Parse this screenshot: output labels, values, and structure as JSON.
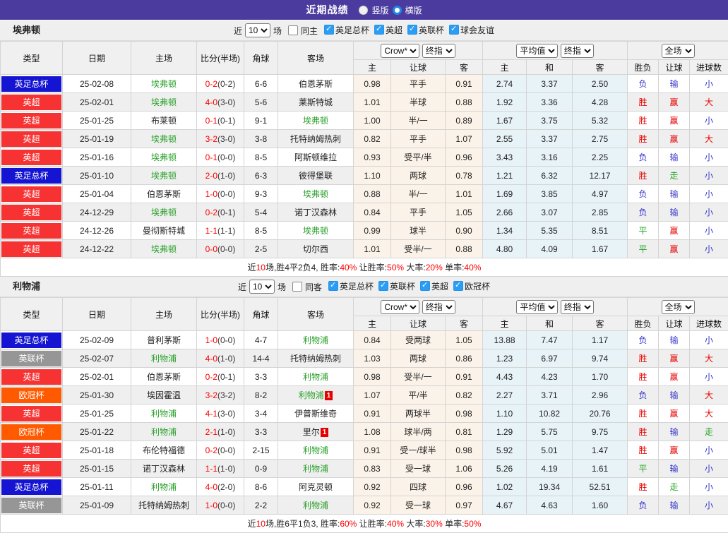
{
  "title_bar": {
    "title": "近期战绩",
    "options": [
      {
        "label": "竖版",
        "selected": false
      },
      {
        "label": "横版",
        "selected": true
      }
    ]
  },
  "selects": {
    "book": "Crow*",
    "final": "终指",
    "avg": "平均值",
    "scope": "全场"
  },
  "table_header": {
    "type": "类型",
    "date": "日期",
    "home": "主场",
    "score": "比分(半场)",
    "corner": "角球",
    "away": "客场",
    "sub": [
      "主",
      "让球",
      "客",
      "主",
      "和",
      "客",
      "胜负",
      "让球",
      "进球数"
    ]
  },
  "league_colors": {
    "英足总杯": "#1414d2",
    "英超": "#f73232",
    "英联杯": "#969696",
    "欧冠杯": "#ff5a00",
    "球会友谊": "#969696"
  },
  "sections": [
    {
      "team": "埃弗顿",
      "filter": {
        "near_label": "近",
        "count": "10",
        "matches_label": "场",
        "same_label": "同主",
        "same_checked": false,
        "leagues": [
          "英足总杯",
          "英超",
          "英联杯",
          "球会友谊"
        ]
      },
      "rows": [
        {
          "league": "英足总杯",
          "date": "25-02-08",
          "home": "埃弗顿",
          "home_active": true,
          "score": "0-2",
          "half": "(0-2)",
          "corners": "6-6",
          "away": "伯恩茅斯",
          "away_active": false,
          "asian": [
            "0.98",
            "平手",
            "0.91"
          ],
          "euro": [
            "2.74",
            "3.37",
            "2.50"
          ],
          "results": [
            {
              "text": "负",
              "color": "blue"
            },
            {
              "text": "输",
              "color": "blue"
            },
            {
              "text": "小",
              "color": "blue"
            }
          ]
        },
        {
          "league": "英超",
          "date": "25-02-01",
          "home": "埃弗顿",
          "home_active": true,
          "score": "4-0",
          "half": "(3-0)",
          "corners": "5-6",
          "away": "莱斯特城",
          "away_active": false,
          "asian": [
            "1.01",
            "半球",
            "0.88"
          ],
          "euro": [
            "1.92",
            "3.36",
            "4.28"
          ],
          "results": [
            {
              "text": "胜",
              "color": "red"
            },
            {
              "text": "赢",
              "color": "red"
            },
            {
              "text": "大",
              "color": "red"
            }
          ]
        },
        {
          "league": "英超",
          "date": "25-01-25",
          "home": "布莱顿",
          "home_active": false,
          "score": "0-1",
          "half": "(0-1)",
          "corners": "9-1",
          "away": "埃弗顿",
          "away_active": true,
          "asian": [
            "1.00",
            "半/一",
            "0.89"
          ],
          "euro": [
            "1.67",
            "3.75",
            "5.32"
          ],
          "results": [
            {
              "text": "胜",
              "color": "red"
            },
            {
              "text": "赢",
              "color": "red"
            },
            {
              "text": "小",
              "color": "blue"
            }
          ]
        },
        {
          "league": "英超",
          "date": "25-01-19",
          "home": "埃弗顿",
          "home_active": true,
          "score": "3-2",
          "half": "(3-0)",
          "corners": "3-8",
          "away": "托特纳姆热刺",
          "away_active": false,
          "asian": [
            "0.82",
            "平手",
            "1.07"
          ],
          "euro": [
            "2.55",
            "3.37",
            "2.75"
          ],
          "results": [
            {
              "text": "胜",
              "color": "red"
            },
            {
              "text": "赢",
              "color": "red"
            },
            {
              "text": "大",
              "color": "red"
            }
          ]
        },
        {
          "league": "英超",
          "date": "25-01-16",
          "home": "埃弗顿",
          "home_active": true,
          "score": "0-1",
          "half": "(0-0)",
          "corners": "8-5",
          "away": "阿斯顿维拉",
          "away_active": false,
          "asian": [
            "0.93",
            "受平/半",
            "0.96"
          ],
          "euro": [
            "3.43",
            "3.16",
            "2.25"
          ],
          "results": [
            {
              "text": "负",
              "color": "blue"
            },
            {
              "text": "输",
              "color": "blue"
            },
            {
              "text": "小",
              "color": "blue"
            }
          ]
        },
        {
          "league": "英足总杯",
          "date": "25-01-10",
          "home": "埃弗顿",
          "home_active": true,
          "score": "2-0",
          "half": "(1-0)",
          "corners": "6-3",
          "away": "彼得堡联",
          "away_active": false,
          "asian": [
            "1.10",
            "两球",
            "0.78"
          ],
          "euro": [
            "1.21",
            "6.32",
            "12.17"
          ],
          "results": [
            {
              "text": "胜",
              "color": "red"
            },
            {
              "text": "走",
              "color": "green"
            },
            {
              "text": "小",
              "color": "blue"
            }
          ]
        },
        {
          "league": "英超",
          "date": "25-01-04",
          "home": "伯恩茅斯",
          "home_active": false,
          "score": "1-0",
          "half": "(0-0)",
          "corners": "9-3",
          "away": "埃弗顿",
          "away_active": true,
          "asian": [
            "0.88",
            "半/一",
            "1.01"
          ],
          "euro": [
            "1.69",
            "3.85",
            "4.97"
          ],
          "results": [
            {
              "text": "负",
              "color": "blue"
            },
            {
              "text": "输",
              "color": "blue"
            },
            {
              "text": "小",
              "color": "blue"
            }
          ]
        },
        {
          "league": "英超",
          "date": "24-12-29",
          "home": "埃弗顿",
          "home_active": true,
          "score": "0-2",
          "half": "(0-1)",
          "corners": "5-4",
          "away": "诺丁汉森林",
          "away_active": false,
          "asian": [
            "0.84",
            "平手",
            "1.05"
          ],
          "euro": [
            "2.66",
            "3.07",
            "2.85"
          ],
          "results": [
            {
              "text": "负",
              "color": "blue"
            },
            {
              "text": "输",
              "color": "blue"
            },
            {
              "text": "小",
              "color": "blue"
            }
          ]
        },
        {
          "league": "英超",
          "date": "24-12-26",
          "home": "曼彻斯特城",
          "home_active": false,
          "score": "1-1",
          "half": "(1-1)",
          "corners": "8-5",
          "away": "埃弗顿",
          "away_active": true,
          "asian": [
            "0.99",
            "球半",
            "0.90"
          ],
          "euro": [
            "1.34",
            "5.35",
            "8.51"
          ],
          "results": [
            {
              "text": "平",
              "color": "green"
            },
            {
              "text": "赢",
              "color": "red"
            },
            {
              "text": "小",
              "color": "blue"
            }
          ]
        },
        {
          "league": "英超",
          "date": "24-12-22",
          "home": "埃弗顿",
          "home_active": true,
          "score": "0-0",
          "half": "(0-0)",
          "corners": "2-5",
          "away": "切尔西",
          "away_active": false,
          "asian": [
            "1.01",
            "受半/一",
            "0.88"
          ],
          "euro": [
            "4.80",
            "4.09",
            "1.67"
          ],
          "results": [
            {
              "text": "平",
              "color": "green"
            },
            {
              "text": "赢",
              "color": "red"
            },
            {
              "text": "小",
              "color": "blue"
            }
          ]
        }
      ],
      "summary": [
        {
          "t": "近"
        },
        {
          "t": "10",
          "hl": true
        },
        {
          "t": "场,胜4平2负4, 胜率:"
        },
        {
          "t": "40%",
          "hl": true
        },
        {
          "t": " 让胜率:"
        },
        {
          "t": "50%",
          "hl": true
        },
        {
          "t": " 大率:"
        },
        {
          "t": "20%",
          "hl": true
        },
        {
          "t": " 单率:"
        },
        {
          "t": "40%",
          "hl": true
        }
      ]
    },
    {
      "team": "利物浦",
      "filter": {
        "near_label": "近",
        "count": "10",
        "matches_label": "场",
        "same_label": "同客",
        "same_checked": false,
        "leagues": [
          "英足总杯",
          "英联杯",
          "英超",
          "欧冠杯"
        ]
      },
      "rows": [
        {
          "league": "英足总杯",
          "date": "25-02-09",
          "home": "普利茅斯",
          "home_active": false,
          "score": "1-0",
          "half": "(0-0)",
          "corners": "4-7",
          "away": "利物浦",
          "away_active": true,
          "asian": [
            "0.84",
            "受两球",
            "1.05"
          ],
          "euro": [
            "13.88",
            "7.47",
            "1.17"
          ],
          "results": [
            {
              "text": "负",
              "color": "blue"
            },
            {
              "text": "输",
              "color": "blue"
            },
            {
              "text": "小",
              "color": "blue"
            }
          ]
        },
        {
          "league": "英联杯",
          "date": "25-02-07",
          "home": "利物浦",
          "home_active": true,
          "score": "4-0",
          "half": "(1-0)",
          "corners": "14-4",
          "away": "托特纳姆热刺",
          "away_active": false,
          "asian": [
            "1.03",
            "两球",
            "0.86"
          ],
          "euro": [
            "1.23",
            "6.97",
            "9.74"
          ],
          "results": [
            {
              "text": "胜",
              "color": "red"
            },
            {
              "text": "赢",
              "color": "red"
            },
            {
              "text": "大",
              "color": "red"
            }
          ]
        },
        {
          "league": "英超",
          "date": "25-02-01",
          "home": "伯恩茅斯",
          "home_active": false,
          "score": "0-2",
          "half": "(0-1)",
          "corners": "3-3",
          "away": "利物浦",
          "away_active": true,
          "asian": [
            "0.98",
            "受半/一",
            "0.91"
          ],
          "euro": [
            "4.43",
            "4.23",
            "1.70"
          ],
          "results": [
            {
              "text": "胜",
              "color": "red"
            },
            {
              "text": "赢",
              "color": "red"
            },
            {
              "text": "小",
              "color": "blue"
            }
          ]
        },
        {
          "league": "欧冠杯",
          "date": "25-01-30",
          "home": "埃因霍温",
          "home_active": false,
          "score": "3-2",
          "half": "(3-2)",
          "corners": "8-2",
          "away": "利物浦",
          "away_active": true,
          "away_badge": "1",
          "asian": [
            "1.07",
            "平/半",
            "0.82"
          ],
          "euro": [
            "2.27",
            "3.71",
            "2.96"
          ],
          "results": [
            {
              "text": "负",
              "color": "blue"
            },
            {
              "text": "输",
              "color": "blue"
            },
            {
              "text": "大",
              "color": "red"
            }
          ]
        },
        {
          "league": "英超",
          "date": "25-01-25",
          "home": "利物浦",
          "home_active": true,
          "score": "4-1",
          "half": "(3-0)",
          "corners": "3-4",
          "away": "伊普斯维奇",
          "away_active": false,
          "asian": [
            "0.91",
            "两球半",
            "0.98"
          ],
          "euro": [
            "1.10",
            "10.82",
            "20.76"
          ],
          "results": [
            {
              "text": "胜",
              "color": "red"
            },
            {
              "text": "赢",
              "color": "red"
            },
            {
              "text": "大",
              "color": "red"
            }
          ]
        },
        {
          "league": "欧冠杯",
          "date": "25-01-22",
          "home": "利物浦",
          "home_active": true,
          "score": "2-1",
          "half": "(1-0)",
          "corners": "3-3",
          "away": "里尔",
          "away_active": false,
          "away_badge": "1",
          "asian": [
            "1.08",
            "球半/两",
            "0.81"
          ],
          "euro": [
            "1.29",
            "5.75",
            "9.75"
          ],
          "results": [
            {
              "text": "胜",
              "color": "red"
            },
            {
              "text": "输",
              "color": "blue"
            },
            {
              "text": "走",
              "color": "green"
            }
          ]
        },
        {
          "league": "英超",
          "date": "25-01-18",
          "home": "布伦特福德",
          "home_active": false,
          "score": "0-2",
          "half": "(0-0)",
          "corners": "2-15",
          "away": "利物浦",
          "away_active": true,
          "asian": [
            "0.91",
            "受一/球半",
            "0.98"
          ],
          "euro": [
            "5.92",
            "5.01",
            "1.47"
          ],
          "results": [
            {
              "text": "胜",
              "color": "red"
            },
            {
              "text": "赢",
              "color": "red"
            },
            {
              "text": "小",
              "color": "blue"
            }
          ]
        },
        {
          "league": "英超",
          "date": "25-01-15",
          "home": "诺丁汉森林",
          "home_active": false,
          "score": "1-1",
          "half": "(1-0)",
          "corners": "0-9",
          "away": "利物浦",
          "away_active": true,
          "asian": [
            "0.83",
            "受一球",
            "1.06"
          ],
          "euro": [
            "5.26",
            "4.19",
            "1.61"
          ],
          "results": [
            {
              "text": "平",
              "color": "green"
            },
            {
              "text": "输",
              "color": "blue"
            },
            {
              "text": "小",
              "color": "blue"
            }
          ]
        },
        {
          "league": "英足总杯",
          "date": "25-01-11",
          "home": "利物浦",
          "home_active": true,
          "score": "4-0",
          "half": "(2-0)",
          "corners": "8-6",
          "away": "阿克灵顿",
          "away_active": false,
          "asian": [
            "0.92",
            "四球",
            "0.96"
          ],
          "euro": [
            "1.02",
            "19.34",
            "52.51"
          ],
          "results": [
            {
              "text": "胜",
              "color": "red"
            },
            {
              "text": "走",
              "color": "green"
            },
            {
              "text": "小",
              "color": "blue"
            }
          ]
        },
        {
          "league": "英联杯",
          "date": "25-01-09",
          "home": "托特纳姆热刺",
          "home_active": false,
          "score": "1-0",
          "half": "(0-0)",
          "corners": "2-2",
          "away": "利物浦",
          "away_active": true,
          "asian": [
            "0.92",
            "受一球",
            "0.97"
          ],
          "euro": [
            "4.67",
            "4.63",
            "1.60"
          ],
          "results": [
            {
              "text": "负",
              "color": "blue"
            },
            {
              "text": "输",
              "color": "blue"
            },
            {
              "text": "小",
              "color": "blue"
            }
          ]
        }
      ],
      "summary": [
        {
          "t": "近"
        },
        {
          "t": "10",
          "hl": true
        },
        {
          "t": "场,胜6平1负3, 胜率:"
        },
        {
          "t": "60%",
          "hl": true
        },
        {
          "t": " 让胜率:"
        },
        {
          "t": "40%",
          "hl": true
        },
        {
          "t": " 大率:"
        },
        {
          "t": "30%",
          "hl": true
        },
        {
          "t": " 单率:"
        },
        {
          "t": "50%",
          "hl": true
        }
      ]
    }
  ]
}
